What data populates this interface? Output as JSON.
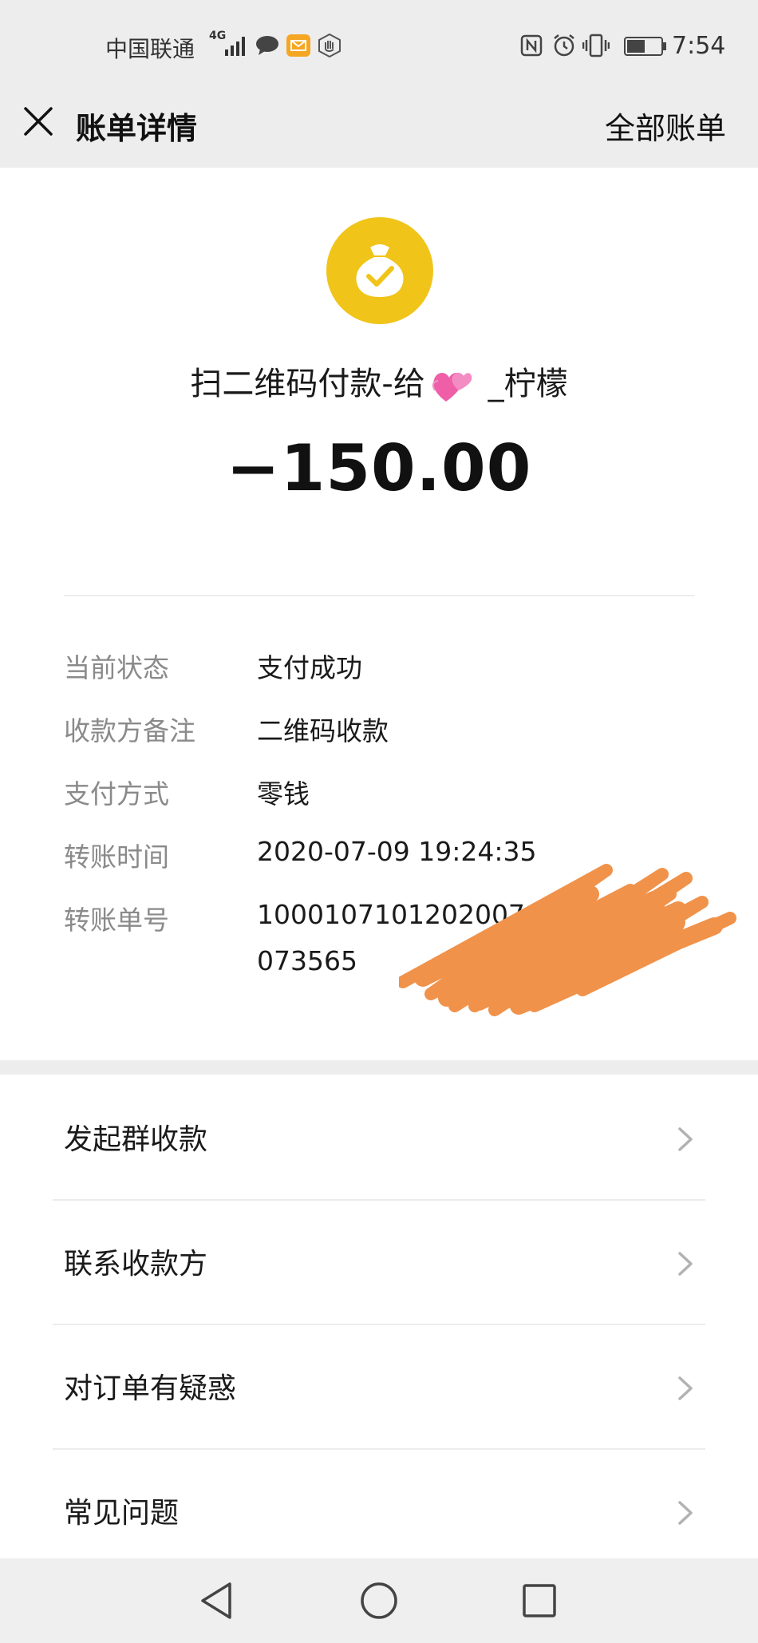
{
  "status_bar": {
    "carrier": "中国联通",
    "network": "4G",
    "time": "7:54",
    "icons": [
      "signal-icon",
      "message-icon",
      "mail-icon",
      "hand-icon",
      "nfc-icon",
      "alarm-icon",
      "vibrate-icon",
      "battery-icon"
    ]
  },
  "nav": {
    "title": "账单详情",
    "right_link": "全部账单",
    "close_icon": "close-icon"
  },
  "transaction": {
    "icon": "money-bag-check-icon",
    "title_prefix": "扫二维码付款-给",
    "title_suffix": " _柠檬",
    "amount": "−150.00",
    "details": [
      {
        "label": "当前状态",
        "value": "支付成功"
      },
      {
        "label": "收款方备注",
        "value": "二维码收款"
      },
      {
        "label": "支付方式",
        "value": "零钱"
      },
      {
        "label": "转账时间",
        "value": "2020-07-09 19:24:35"
      },
      {
        "label": "转账单号",
        "value_line1": "1000107101202007",
        "value_line2": "073565"
      }
    ]
  },
  "actions": [
    {
      "label": "发起群收款"
    },
    {
      "label": "联系收款方"
    },
    {
      "label": "对订单有疑惑"
    },
    {
      "label": "常见问题"
    }
  ],
  "colors": {
    "bag_icon": "#f0c419",
    "scribble": "#f0924a",
    "background": "#ededed"
  }
}
